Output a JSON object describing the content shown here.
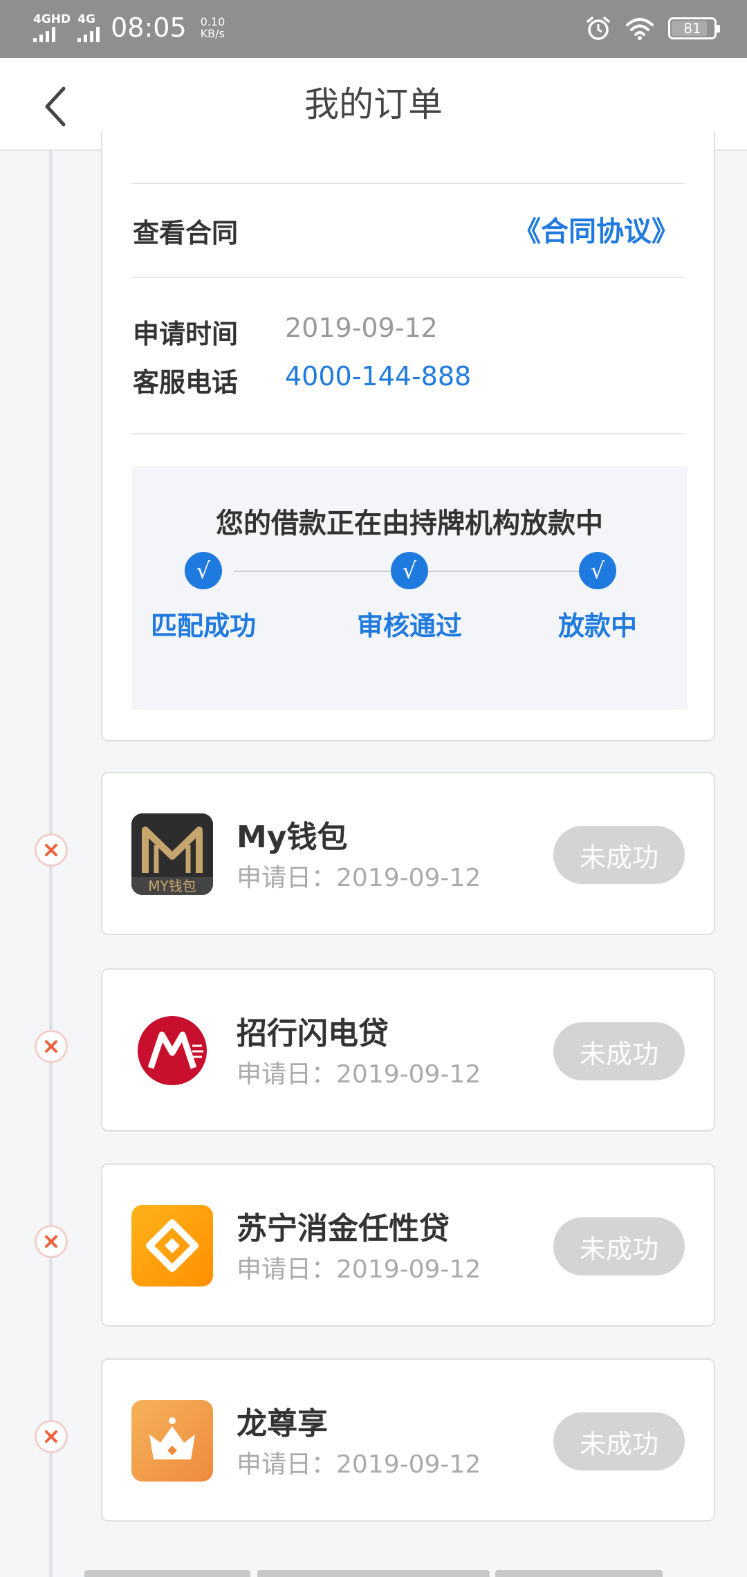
{
  "status_bar": {
    "sim1_label": "4GHD",
    "sim2_label": "4G",
    "time": "08:05",
    "net_speed_value": "0.10",
    "net_speed_unit": "KB/s",
    "battery_level": "81",
    "icons": [
      "signal-icon",
      "alarm-icon",
      "wifi-icon",
      "battery-icon"
    ]
  },
  "header": {
    "title": "我的订单",
    "back_icon": "chevron-left-icon"
  },
  "detail": {
    "contract_label": "查看合同",
    "contract_link": "《合同协议》",
    "apply_time_label": "申请时间",
    "apply_time_value": "2019-09-12",
    "service_phone_label": "客服电话",
    "service_phone_value": "4000-144-888",
    "progress": {
      "title": "您的借款正在由持牌机构放款中",
      "check_glyph": "√",
      "steps": [
        {
          "label": "匹配成功"
        },
        {
          "label": "审核通过"
        },
        {
          "label": "放款中"
        }
      ]
    }
  },
  "orders": [
    {
      "name": "My钱包",
      "logo_text": "MY钱包",
      "date_label": "申请日：",
      "date": "2019-09-12",
      "status": "未成功",
      "logo": "my-wallet-logo"
    },
    {
      "name": "招行闪电贷",
      "date_label": "申请日：",
      "date": "2019-09-12",
      "status": "未成功",
      "logo": "cmb-logo"
    },
    {
      "name": "苏宁消金任性贷",
      "date_label": "申请日：",
      "date": "2019-09-12",
      "status": "未成功",
      "logo": "suning-logo"
    },
    {
      "name": "龙尊享",
      "date_label": "申请日：",
      "date": "2019-09-12",
      "status": "未成功",
      "logo": "crown-logo"
    }
  ],
  "colors": {
    "accent": "#1f7ae0",
    "fail_mark": "#f0603c",
    "status_bar": "#8f8f8f",
    "pill_bg": "#d4d4d4"
  }
}
